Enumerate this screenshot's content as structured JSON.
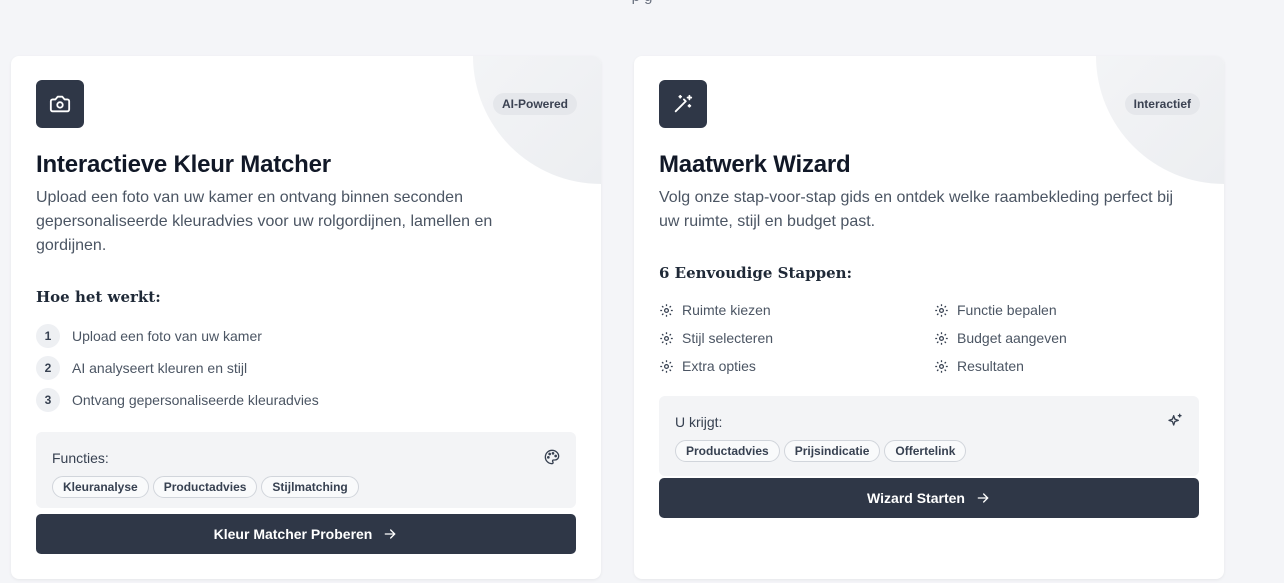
{
  "cards": [
    {
      "title": "Interactieve Kleur Matcher",
      "badge": "AI-Powered",
      "icon": "camera-icon",
      "description": "Upload een foto van uw kamer en ontvang binnen seconden gepersonaliseerde kleuradvies voor uw rolgordijnen, lamellen en gordijnen.",
      "section_title": "Hoe het werkt:",
      "steps": [
        {
          "num": "1",
          "text": "Upload een foto van uw kamer"
        },
        {
          "num": "2",
          "text": "AI analyseert kleuren en stijl"
        },
        {
          "num": "3",
          "text": "Ontvang gepersonaliseerde kleuradvies"
        }
      ],
      "features_label": "Functies:",
      "features_icon": "palette-icon",
      "features": [
        "Kleuranalyse",
        "Productadvies",
        "Stijlmatching"
      ],
      "cta": "Kleur Matcher Proberen"
    },
    {
      "title": "Maatwerk Wizard",
      "badge": "Interactief",
      "icon": "magic-wand-icon",
      "description": "Volg onze stap-voor-stap gids en ontdek welke raambekleding perfect bij uw ruimte, stijl en budget past.",
      "section_title": "6 Eenvoudige Stappen:",
      "steps": [
        {
          "text": "Ruimte kiezen"
        },
        {
          "text": "Functie bepalen"
        },
        {
          "text": "Stijl selecteren"
        },
        {
          "text": "Budget aangeven"
        },
        {
          "text": "Extra opties"
        },
        {
          "text": "Resultaten"
        }
      ],
      "features_label": "U krijgt:",
      "features_icon": "sparkles-icon",
      "features": [
        "Productadvies",
        "Prijsindicatie",
        "Offertelink"
      ],
      "cta": "Wizard Starten"
    }
  ]
}
